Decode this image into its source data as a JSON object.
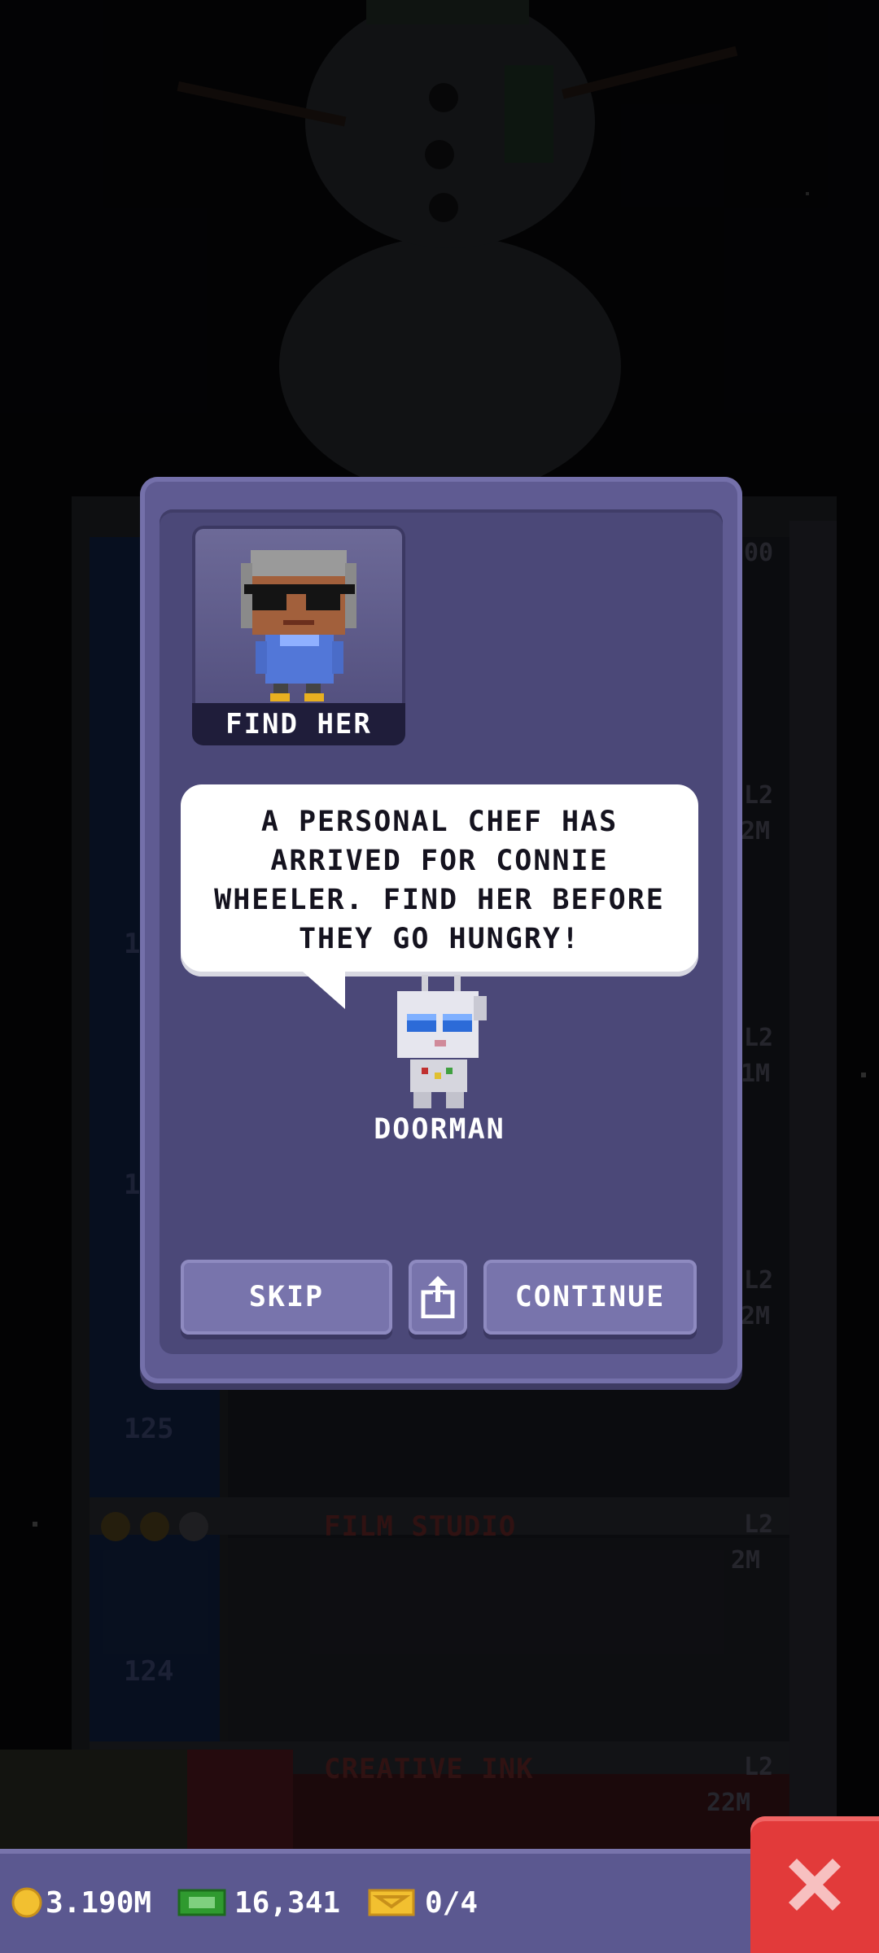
{
  "dialog": {
    "portrait_label": "FIND HER",
    "message": "A PERSONAL CHEF HAS ARRIVED FOR CONNIE WHEELER. FIND HER BEFORE THEY GO HUNGRY!",
    "speaker": "DOORMAN",
    "buttons": {
      "skip": "SKIP",
      "continue": "CONTINUE"
    },
    "share_icon": "share-icon"
  },
  "background": {
    "floors": [
      "125",
      "124"
    ],
    "shops": [
      {
        "name": "FILM STUDIO",
        "level": "L2",
        "value": "2M"
      },
      {
        "name": "CREATIVE INK",
        "level": "L2",
        "value": "22M"
      }
    ],
    "partial_labels": {
      "top_right": "00",
      "levels": [
        "L2",
        "L2",
        "L2"
      ],
      "values": [
        "2M",
        "1M",
        "2M"
      ],
      "left_floor": [
        "1",
        "1"
      ]
    }
  },
  "status_bar": {
    "coins": "3.190M",
    "bux": "16,341",
    "tickets": "0/4",
    "icons": [
      "coin-icon",
      "bux-icon",
      "ticket-icon"
    ]
  },
  "close_icon": "close-x-icon",
  "colors": {
    "dialog": "#5f5b92",
    "dialog_inner": "#4b4878",
    "button": "#7874ac",
    "close": "#e23a3a"
  }
}
